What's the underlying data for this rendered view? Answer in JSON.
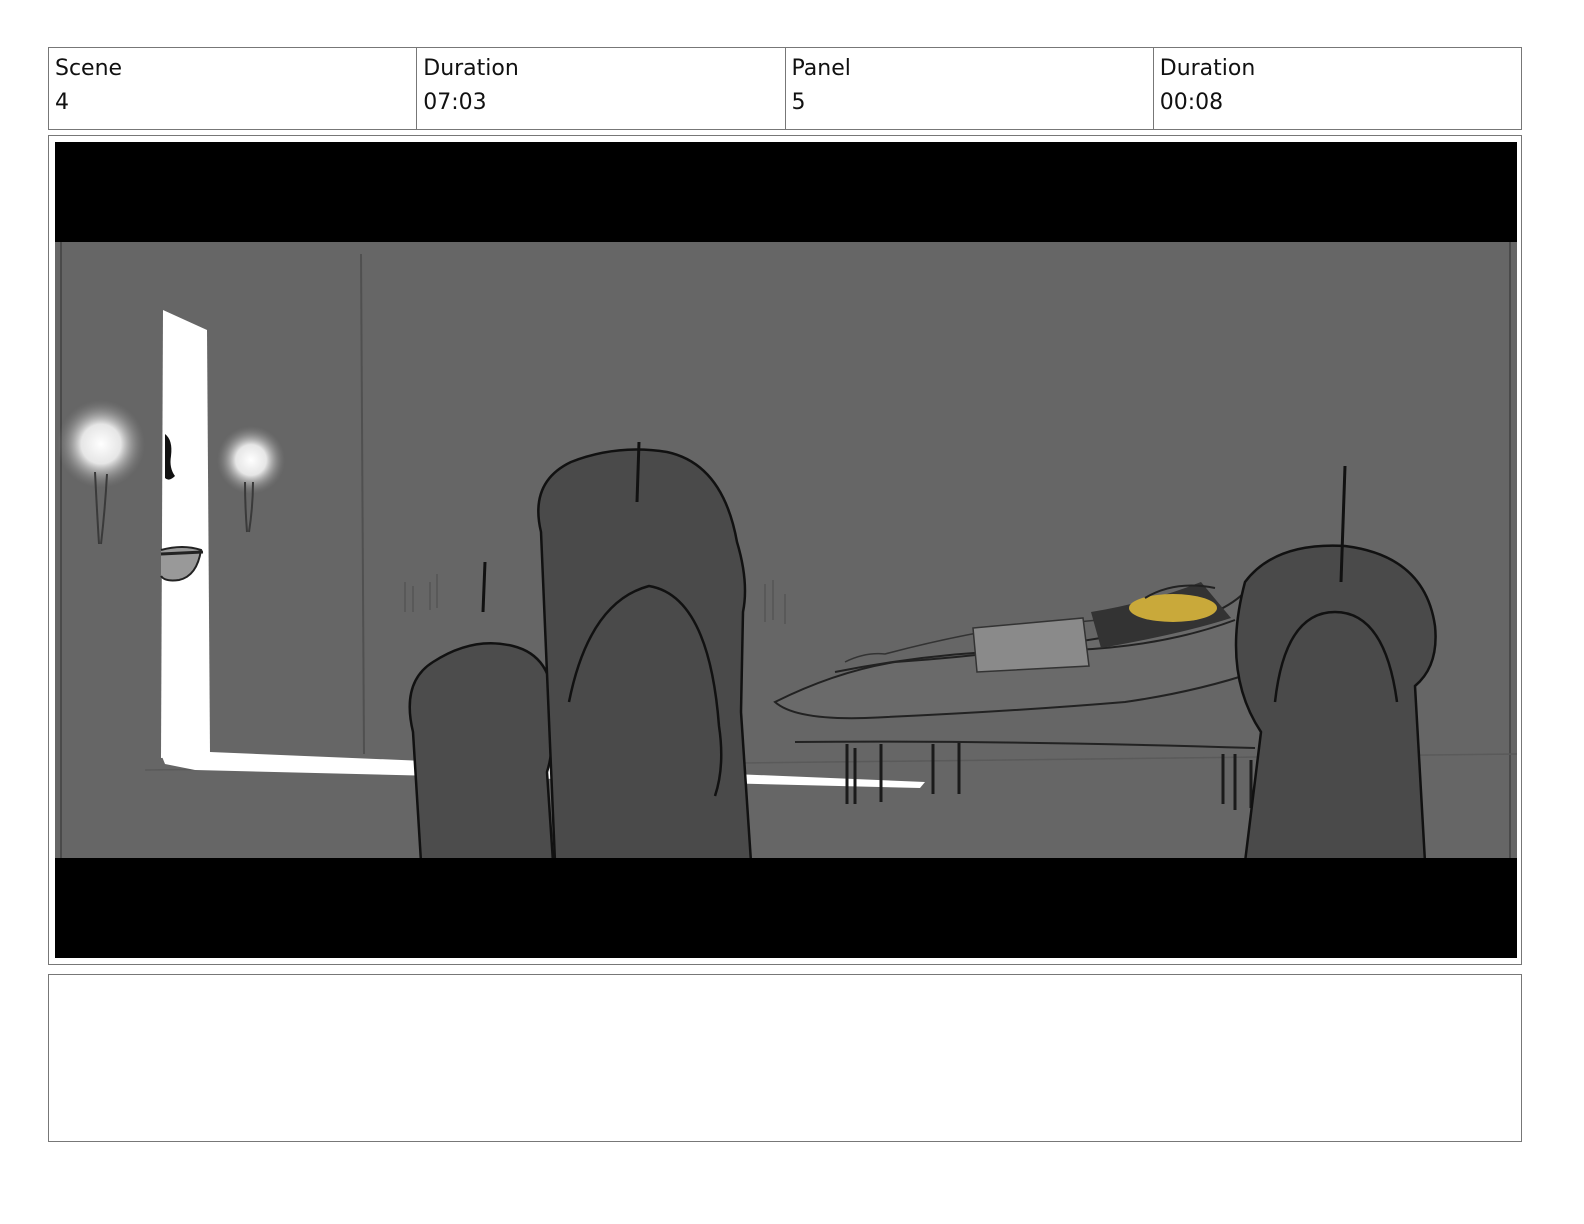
{
  "header": {
    "scene_label": "Scene",
    "scene_value": "4",
    "scene_duration_label": "Duration",
    "scene_duration_value": "07:03",
    "panel_label": "Panel",
    "panel_value": "5",
    "panel_duration_label": "Duration",
    "panel_duration_value": "00:08"
  },
  "notes": {
    "text": ""
  },
  "colors": {
    "letterbox": "#000000",
    "wall": "#666666",
    "candle_dark": "#4a4a4a",
    "highlight_yellow": "#c9a93a"
  }
}
